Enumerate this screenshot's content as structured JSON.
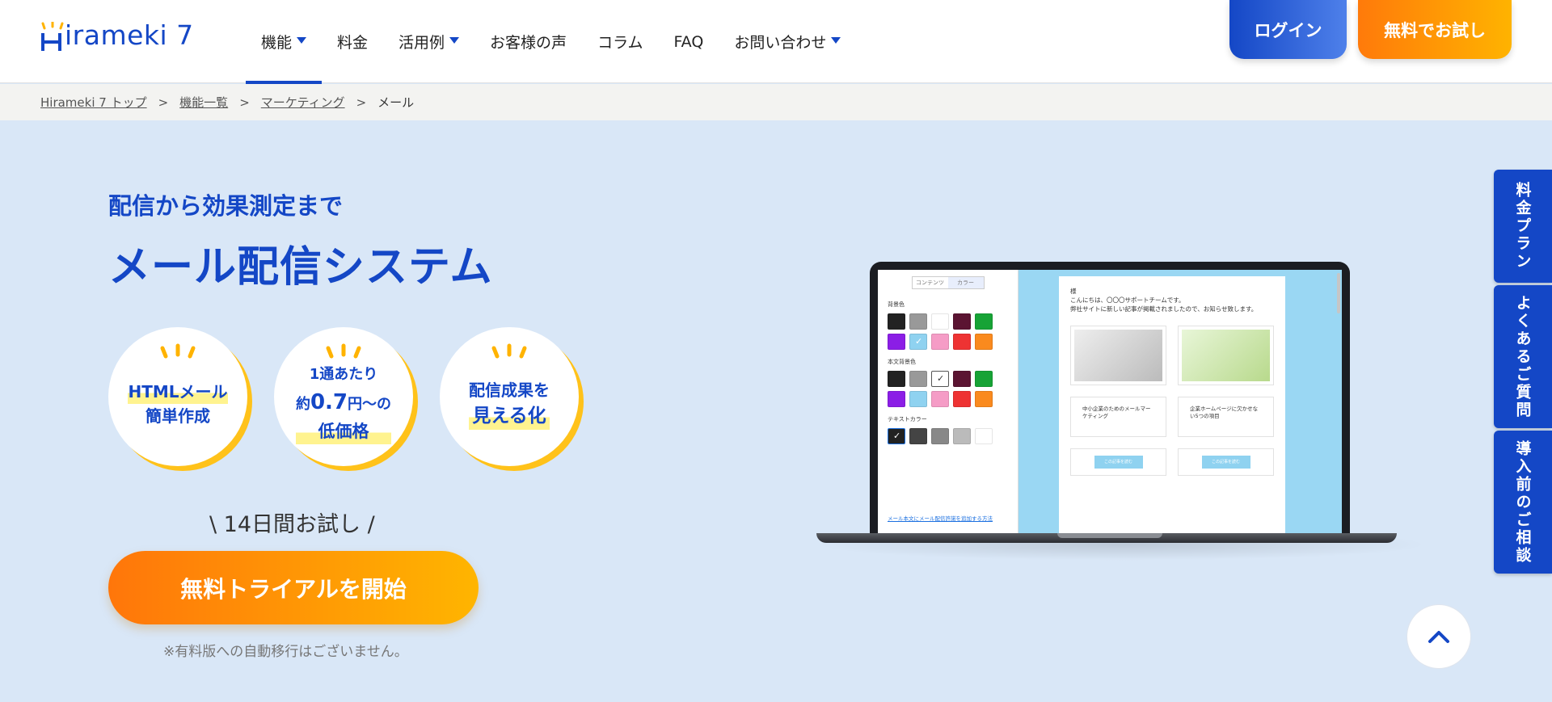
{
  "header": {
    "logo_text": "irameki 7",
    "nav": [
      {
        "label": "機能"
      },
      {
        "label": "料金"
      },
      {
        "label": "活用例"
      },
      {
        "label": "お客様の声"
      },
      {
        "label": "コラム"
      },
      {
        "label": "FAQ"
      },
      {
        "label": "お問い合わせ"
      }
    ],
    "login_label": "ログイン",
    "trial_label": "無料でお試し"
  },
  "breadcrumb": {
    "items": [
      "Hirameki 7 トップ",
      "機能一覧",
      "マーケティング"
    ],
    "current": "メール",
    "separator": ">"
  },
  "hero": {
    "subtitle": "配信から効果測定まで",
    "title": "メール配信システム",
    "badges": [
      {
        "line1": "HTMLメール",
        "line2": "簡単作成"
      },
      {
        "line1": "1通あたり",
        "line2_pre": "約",
        "line2_big": "0.7",
        "line2_post": "円〜の",
        "line3": "低価格"
      },
      {
        "line1": "配信成果を",
        "line2": "見える化"
      }
    ],
    "trial_note": "\\ 14日間お試し /",
    "trial_button": "無料トライアルを開始",
    "no_auto_note": "※有料版への自動移行はございません。"
  },
  "editor": {
    "tab_content": "コンテンツ",
    "tab_color": "カラー",
    "label_bg": "背景色",
    "label_body_bg": "本文背景色",
    "label_text": "テキストカラー",
    "link": "メール本文にメール配信許諾を追加する方法",
    "mail_salutation": "様",
    "mail_line1": "こんにちは、〇〇〇サポートチームです。",
    "mail_line2": "弊社サイトに新しい記事が掲載されましたので、お知らせ致します。",
    "card1_text": "中小企業のためのメールマーケティング",
    "card2_text": "企業ホームページに欠かせない5つの項目",
    "card_btn": "この記事を読む"
  },
  "side_tabs": [
    "料金プラン",
    "よくあるご質問",
    "導入前のご相談"
  ],
  "colors": {
    "brand_blue": "#1447c6",
    "orange": "#ff7a0a",
    "yellow": "#ffb300",
    "hero_bg": "#d9e7f7"
  },
  "icons": {
    "scroll_top": "chevron-up-icon",
    "nav_caret": "caret-down-icon"
  }
}
